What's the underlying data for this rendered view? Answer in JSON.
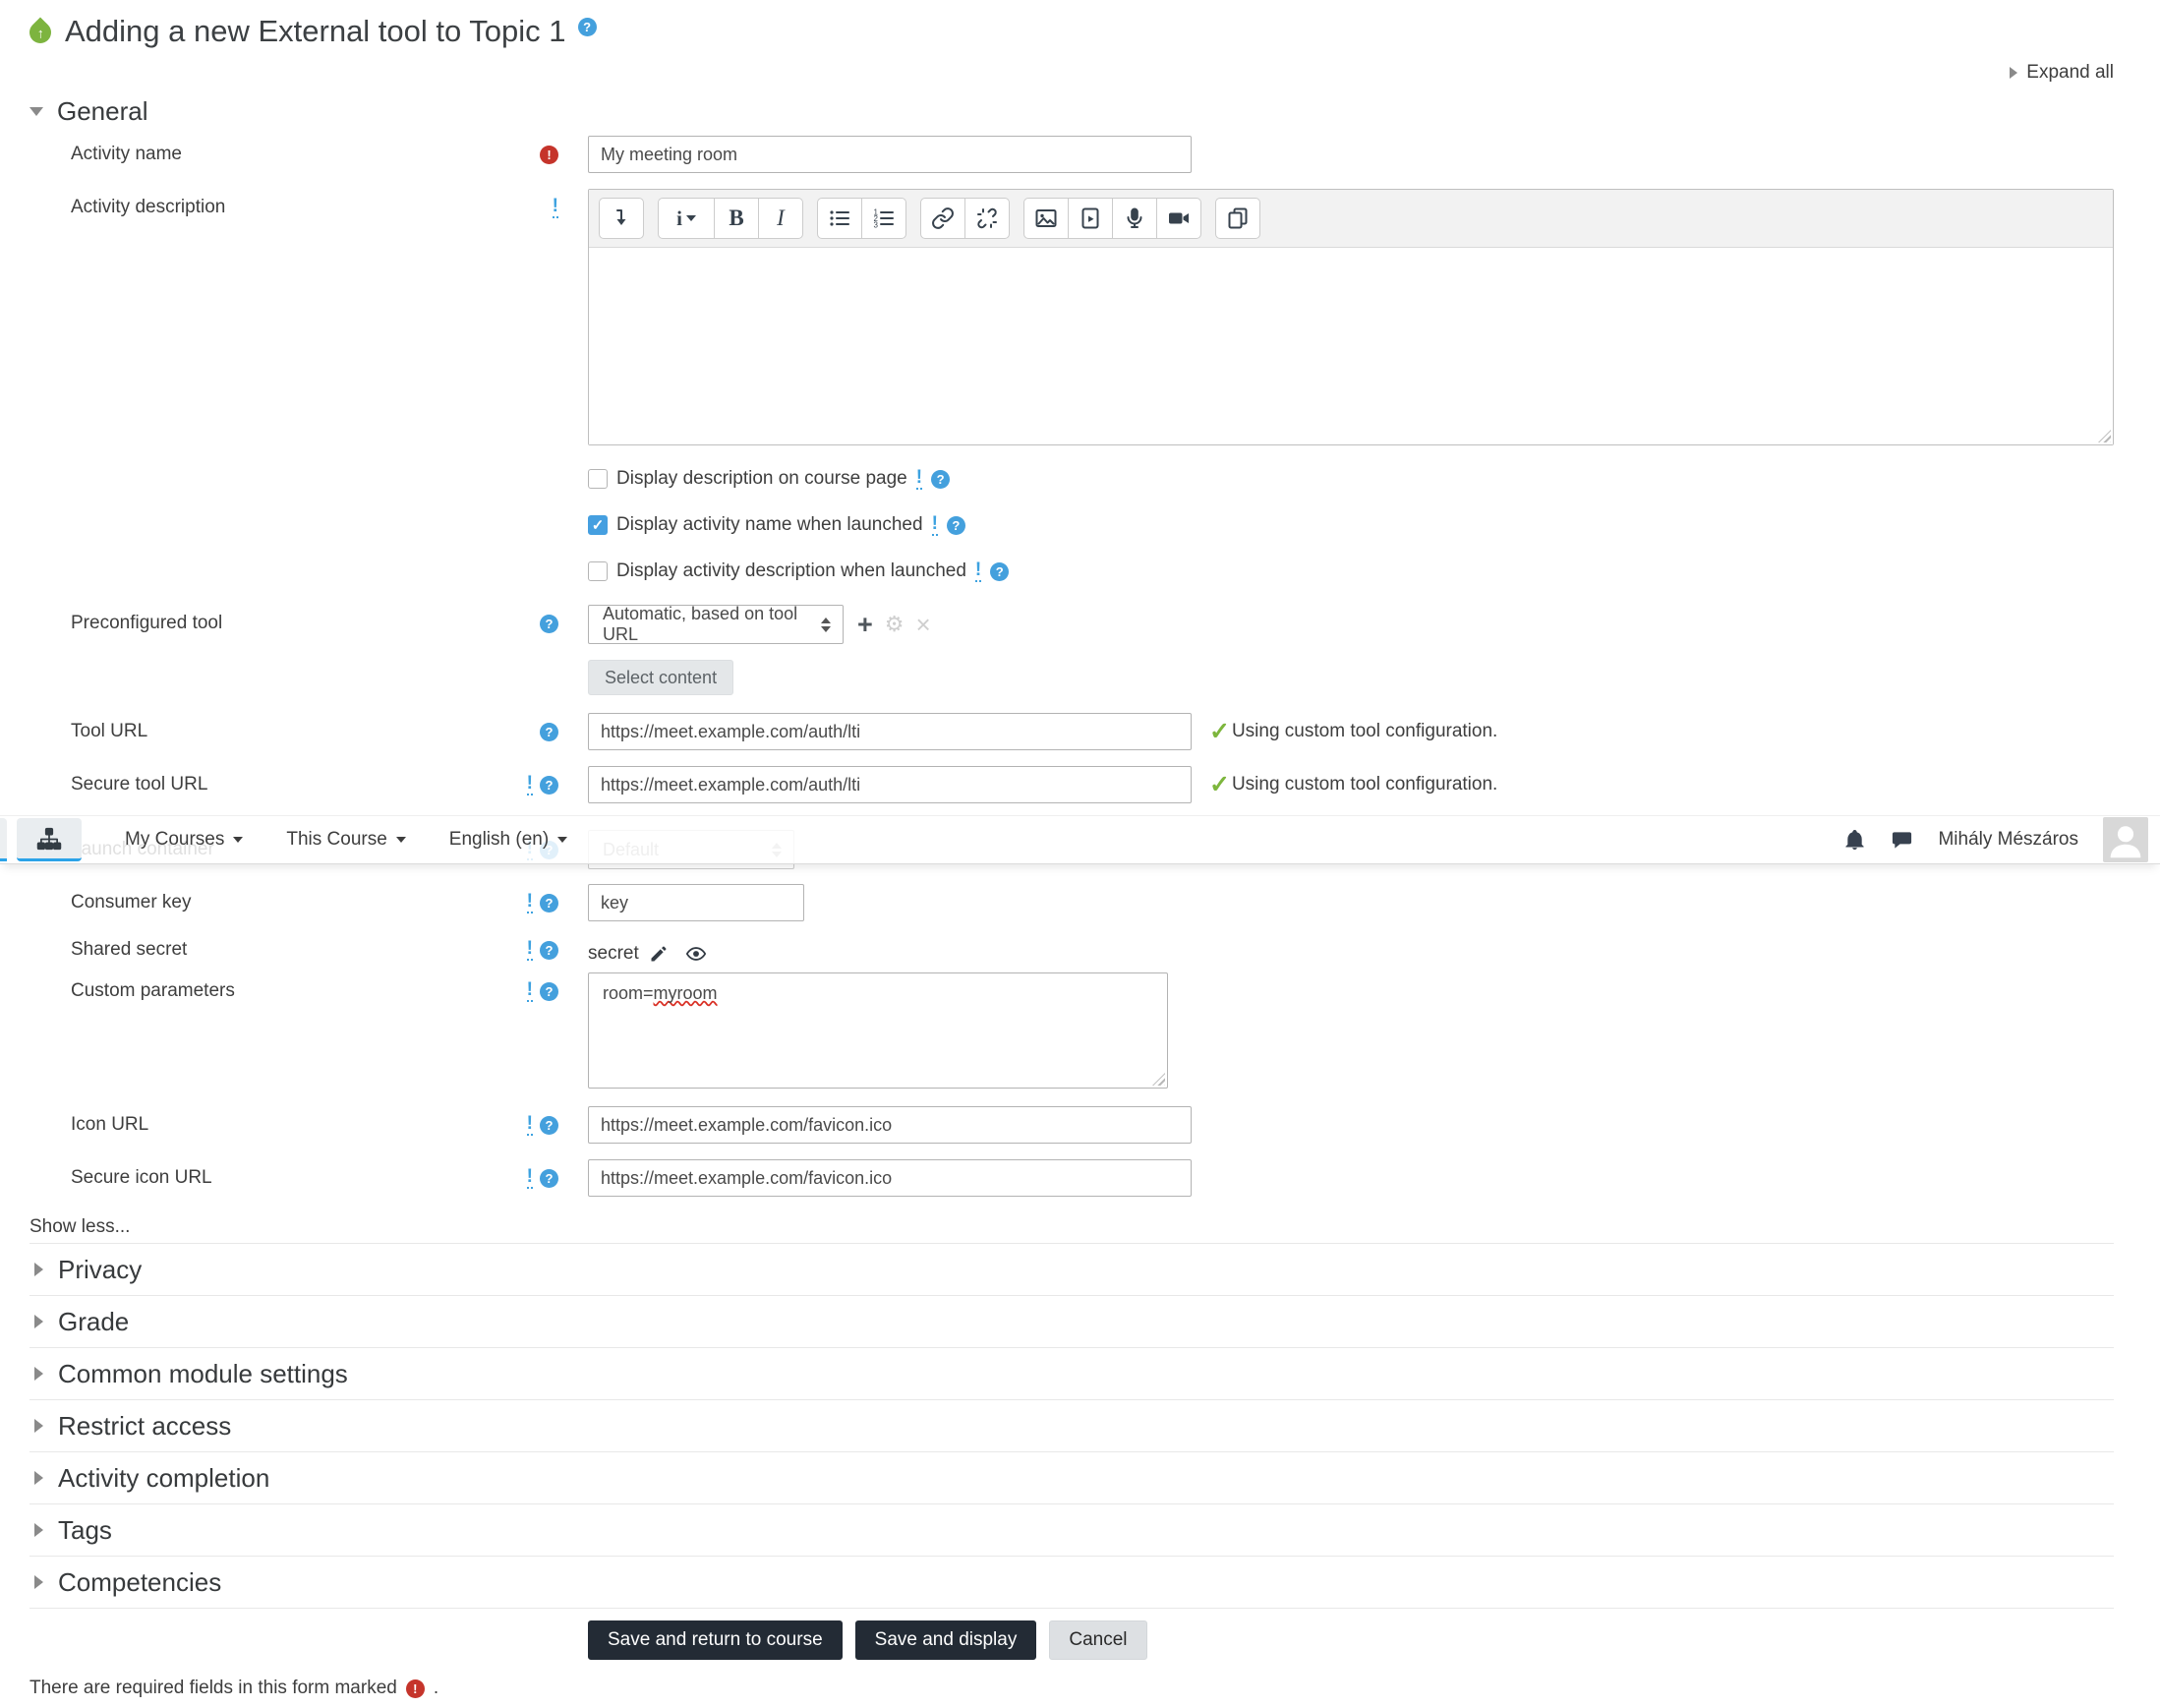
{
  "page": {
    "title": "Adding a new External tool to Topic 1",
    "expand_all_label": "Expand all",
    "required_footer": "There are required fields in this form marked",
    "required_footer_period": "."
  },
  "colors": {
    "accent_blue": "#44a0dd",
    "required_red": "#c5342b",
    "success_green": "#7db63d",
    "primary_button": "#232b35",
    "nav_active_underline": "#2ba3e8",
    "lti_icon_green": "#7db43f",
    "checked_checkbox_blue": "#459fe0"
  },
  "navbar": {
    "menu_items": [
      {
        "label": "My Courses"
      },
      {
        "label": "This Course"
      },
      {
        "label": "English (en)"
      }
    ],
    "user_name": "Mihály Mészáros",
    "icons": [
      "sitemap-icon",
      "notifications-bell-icon",
      "messages-icon",
      "avatar"
    ]
  },
  "form": {
    "general": {
      "heading": "General",
      "activity_name": {
        "label": "Activity name",
        "value": "My meeting room"
      },
      "activity_description": {
        "label": "Activity description",
        "value": ""
      },
      "display_description": {
        "label": "Display description on course page",
        "checked": false
      },
      "display_activity_name": {
        "label": "Display activity name when launched",
        "checked": true,
        "check_glyph": "✓"
      },
      "display_activity_description": {
        "label": "Display activity description when launched",
        "checked": false
      },
      "preconfigured_tool": {
        "label": "Preconfigured tool",
        "selected": "Automatic, based on tool URL"
      },
      "select_content_label": "Select content",
      "tool_url": {
        "label": "Tool URL",
        "value": "https://meet.example.com/auth/lti",
        "status": "Using custom tool configuration.",
        "status_check": "✓"
      },
      "secure_tool_url": {
        "label": "Secure tool URL",
        "value": "https://meet.example.com/auth/lti",
        "status": "Using custom tool configuration.",
        "status_check": "✓"
      },
      "launch_container": {
        "label": "Launch container",
        "selected": "Default"
      },
      "consumer_key": {
        "label": "Consumer key",
        "value": "key"
      },
      "shared_secret": {
        "label": "Shared secret",
        "value": "secret"
      },
      "custom_parameters": {
        "label": "Custom parameters",
        "value_prefix": "room=",
        "value_flagged": "myroom"
      },
      "icon_url": {
        "label": "Icon URL",
        "value": "https://meet.example.com/favicon.ico"
      },
      "secure_icon_url": {
        "label": "Secure icon URL",
        "value": "https://meet.example.com/favicon.ico"
      },
      "show_less_label": "Show less...",
      "required_marker": "!",
      "help_marker": "?",
      "info_marker": "!"
    },
    "collapsed_sections": [
      "Privacy",
      "Grade",
      "Common module settings",
      "Restrict access",
      "Activity completion",
      "Tags",
      "Competencies"
    ],
    "buttons": {
      "save_return": "Save and return to course",
      "save_display": "Save and display",
      "cancel": "Cancel"
    }
  },
  "editor": {
    "toolbar_icons": [
      "collapse-toolbar-icon",
      "paragraph-styles-icon",
      "bold-icon",
      "italic-icon",
      "unordered-list-icon",
      "ordered-list-icon",
      "link-icon",
      "unlink-icon",
      "image-icon",
      "media-icon",
      "record-audio-icon",
      "record-video-icon",
      "manage-files-icon"
    ],
    "bold_glyph": "B",
    "italic_glyph": "I",
    "styles_glyph": "i",
    "up_arrow_glyph": "↑"
  }
}
